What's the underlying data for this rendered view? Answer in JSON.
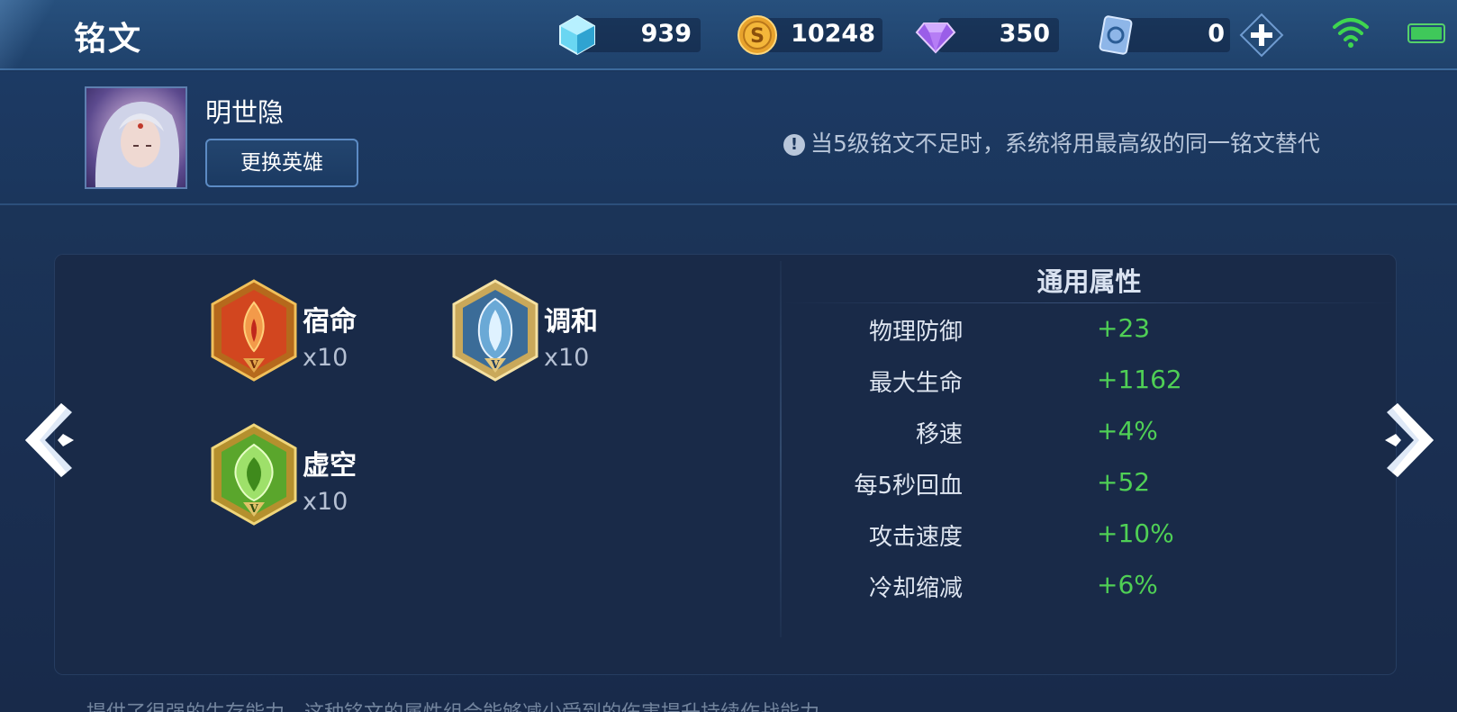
{
  "header": {
    "title": "铭文",
    "currencies": [
      {
        "icon": "crystal-icon",
        "value": "939"
      },
      {
        "icon": "gold-coin-icon",
        "value": "10248"
      },
      {
        "icon": "diamond-icon",
        "value": "350"
      },
      {
        "icon": "ticket-icon",
        "value": "0"
      }
    ],
    "add_button_icon": "plus-icon",
    "wifi_icon": "wifi-icon",
    "battery_icon": "battery-icon",
    "battery_level": 1.0
  },
  "hero": {
    "name": "明世隐",
    "change_button_label": "更换英雄",
    "notice_text": "当5级铭文不足时，系统将用最高级的同一铭文替代"
  },
  "runes": [
    {
      "name": "宿命",
      "count": "x10",
      "color": "#d2461f",
      "level_mark": "V"
    },
    {
      "name": "调和",
      "count": "x10",
      "color": "#3b6c98",
      "level_mark": "V"
    },
    {
      "name": "虚空",
      "count": "x10",
      "color": "#5aa62c",
      "level_mark": "V"
    }
  ],
  "attributes": {
    "title": "通用属性",
    "items": [
      {
        "label": "物理防御",
        "value": "+23"
      },
      {
        "label": "最大生命",
        "value": "+1162"
      },
      {
        "label": "移速",
        "value": "+4%"
      },
      {
        "label": "每5秒回血",
        "value": "+52"
      },
      {
        "label": "攻击速度",
        "value": "+10%"
      },
      {
        "label": "冷却缩减",
        "value": "+6%"
      }
    ]
  },
  "nav": {
    "prev_icon": "chevron-left-icon",
    "next_icon": "chevron-right-icon"
  },
  "footer": {
    "partial_text": "提供了很强的生存能力，这种铭文的属性组合能够减少受到的伤害提升持续作战能力"
  },
  "colors": {
    "accent_green": "#4fcf55",
    "panel_bg": "#192a48",
    "header_bg": "#1f416b"
  }
}
